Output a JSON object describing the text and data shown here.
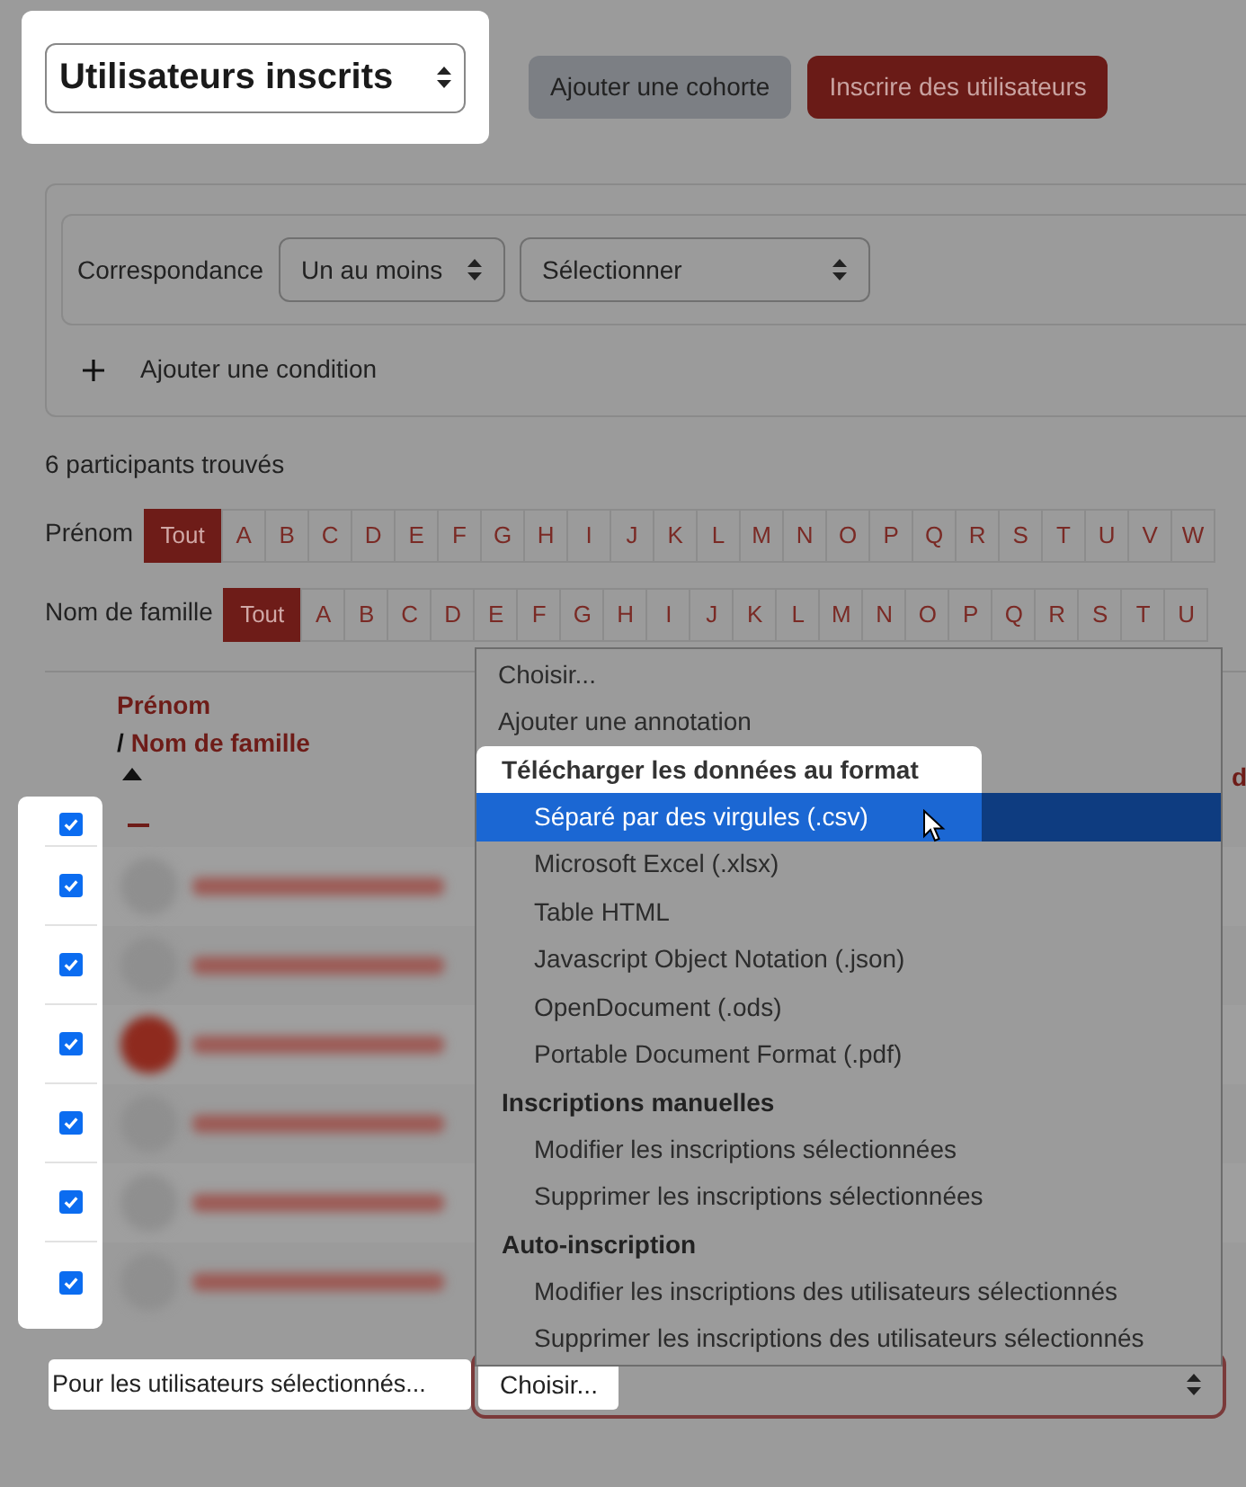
{
  "header": {
    "title_select": "Utilisateurs inscrits",
    "buttons": [
      {
        "label": "Ajouter une cohorte",
        "kind": "secondary"
      },
      {
        "label": "Inscrire des utilisateurs",
        "kind": "primary"
      }
    ]
  },
  "filter": {
    "match_label": "Correspondance",
    "match_select": "Un au moins",
    "type_select": "Sélectionner",
    "add_condition": "Ajouter une condition"
  },
  "count": "6 participants trouvés",
  "initials_bars": [
    {
      "label": "Prénom",
      "letters": [
        {
          "text": "Tout",
          "selected": true
        },
        {
          "text": "A",
          "selected": false
        },
        {
          "text": "B",
          "selected": false
        },
        {
          "text": "C",
          "selected": false
        },
        {
          "text": "D",
          "selected": false
        },
        {
          "text": "E",
          "selected": false
        },
        {
          "text": "F",
          "selected": false
        },
        {
          "text": "G",
          "selected": false
        },
        {
          "text": "H",
          "selected": false
        },
        {
          "text": "I",
          "selected": false
        },
        {
          "text": "J",
          "selected": false
        },
        {
          "text": "K",
          "selected": false
        },
        {
          "text": "L",
          "selected": false
        },
        {
          "text": "M",
          "selected": false
        },
        {
          "text": "N",
          "selected": false
        },
        {
          "text": "O",
          "selected": false
        },
        {
          "text": "P",
          "selected": false
        },
        {
          "text": "Q",
          "selected": false
        },
        {
          "text": "R",
          "selected": false
        },
        {
          "text": "S",
          "selected": false
        },
        {
          "text": "T",
          "selected": false
        },
        {
          "text": "U",
          "selected": false
        },
        {
          "text": "V",
          "selected": false
        },
        {
          "text": "W",
          "selected": false
        }
      ]
    },
    {
      "label": "Nom de famille",
      "letters": [
        {
          "text": "Tout",
          "selected": true
        },
        {
          "text": "A",
          "selected": false
        },
        {
          "text": "B",
          "selected": false
        },
        {
          "text": "C",
          "selected": false
        },
        {
          "text": "D",
          "selected": false
        },
        {
          "text": "E",
          "selected": false
        },
        {
          "text": "F",
          "selected": false
        },
        {
          "text": "G",
          "selected": false
        },
        {
          "text": "H",
          "selected": false
        },
        {
          "text": "I",
          "selected": false
        },
        {
          "text": "J",
          "selected": false
        },
        {
          "text": "K",
          "selected": false
        },
        {
          "text": "L",
          "selected": false
        },
        {
          "text": "M",
          "selected": false
        },
        {
          "text": "N",
          "selected": false
        },
        {
          "text": "O",
          "selected": false
        },
        {
          "text": "P",
          "selected": false
        },
        {
          "text": "Q",
          "selected": false
        },
        {
          "text": "R",
          "selected": false
        },
        {
          "text": "S",
          "selected": false
        },
        {
          "text": "T",
          "selected": false
        },
        {
          "text": "U",
          "selected": false
        }
      ]
    }
  ],
  "table": {
    "first_name_header": "Prénom",
    "separator": "/",
    "last_name_header": "Nom de famille",
    "column_3": "d",
    "select_all_checked": true,
    "rows": [
      {
        "checked": true,
        "kind": "initials"
      },
      {
        "checked": true,
        "kind": "initials"
      },
      {
        "checked": true,
        "kind": "photo"
      },
      {
        "checked": true,
        "kind": "initials"
      },
      {
        "checked": true,
        "kind": "initials"
      },
      {
        "checked": true,
        "kind": "initials"
      }
    ]
  },
  "bulk": {
    "label": "Pour les utilisateurs sélectionnés...",
    "select_value": "Choisir...",
    "menu": [
      {
        "kind": "option",
        "text": "Choisir...",
        "selected": false
      },
      {
        "kind": "option",
        "text": "Ajouter une annotation",
        "selected": false
      },
      {
        "kind": "group",
        "text": "Télécharger les données au format"
      },
      {
        "kind": "suboption",
        "text": "Séparé par des virgules (.csv)",
        "selected": true
      },
      {
        "kind": "suboption",
        "text": "Microsoft Excel (.xlsx)",
        "selected": false
      },
      {
        "kind": "suboption",
        "text": "Table HTML",
        "selected": false
      },
      {
        "kind": "suboption",
        "text": "Javascript Object Notation (.json)",
        "selected": false
      },
      {
        "kind": "suboption",
        "text": "OpenDocument (.ods)",
        "selected": false
      },
      {
        "kind": "suboption",
        "text": "Portable Document Format (.pdf)",
        "selected": false
      },
      {
        "kind": "group",
        "text": "Inscriptions manuelles"
      },
      {
        "kind": "suboption",
        "text": "Modifier les inscriptions sélectionnées",
        "selected": false
      },
      {
        "kind": "suboption",
        "text": "Supprimer les inscriptions sélectionnées",
        "selected": false
      },
      {
        "kind": "group",
        "text": "Auto-inscription"
      },
      {
        "kind": "suboption",
        "text": "Modifier les inscriptions des utilisateurs sélectionnés",
        "selected": false
      },
      {
        "kind": "suboption",
        "text": "Supprimer les inscriptions des utilisateurs sélectionnés",
        "selected": false
      }
    ]
  }
}
